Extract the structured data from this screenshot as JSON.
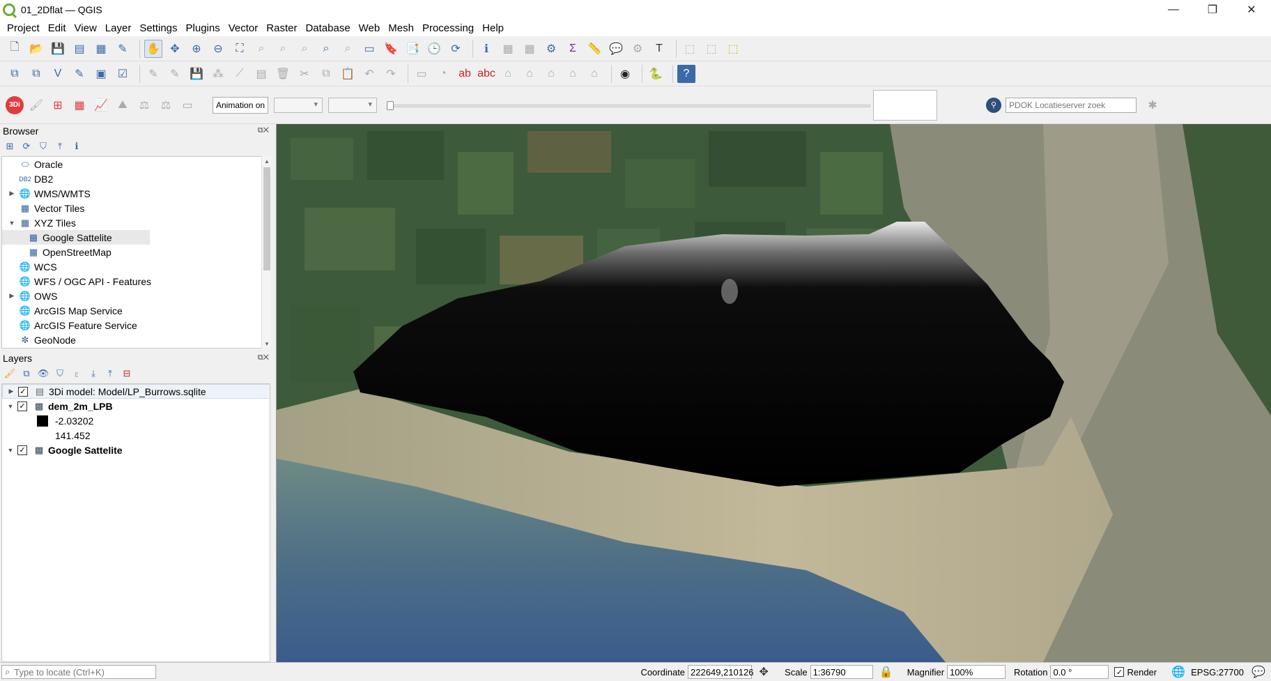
{
  "window": {
    "title": "01_2Dflat — QGIS",
    "controls": [
      "—",
      "❐",
      "✕"
    ]
  },
  "menu": [
    "Project",
    "Edit",
    "View",
    "Layer",
    "Settings",
    "Plugins",
    "Vector",
    "Raster",
    "Database",
    "Web",
    "Mesh",
    "Processing",
    "Help"
  ],
  "toolbar3": {
    "animation_label": "Animation on",
    "pdok_placeholder": "PDOK Locatieserver zoek",
    "threedi_icon": "3Di"
  },
  "browser": {
    "title": "Browser",
    "items": [
      {
        "label": "Oracle",
        "icon": "database-icon",
        "expand": ""
      },
      {
        "label": "DB2",
        "icon": "db2-icon",
        "expand": ""
      },
      {
        "label": "WMS/WMTS",
        "icon": "globe-icon",
        "expand": "▶"
      },
      {
        "label": "Vector Tiles",
        "icon": "grid-icon",
        "expand": ""
      },
      {
        "label": "XYZ Tiles",
        "icon": "grid-icon",
        "expand": "▼"
      },
      {
        "label": "Google Sattelite",
        "icon": "grid-icon",
        "expand": ""
      },
      {
        "label": "OpenStreetMap",
        "icon": "grid-icon",
        "expand": ""
      },
      {
        "label": "WCS",
        "icon": "globe-icon",
        "expand": ""
      },
      {
        "label": "WFS / OGC API - Features",
        "icon": "globe-icon",
        "expand": ""
      },
      {
        "label": "OWS",
        "icon": "globe-icon",
        "expand": "▶"
      },
      {
        "label": "ArcGIS Map Service",
        "icon": "globe-icon",
        "expand": ""
      },
      {
        "label": "ArcGIS Feature Service",
        "icon": "globe-icon",
        "expand": ""
      },
      {
        "label": "GeoNode",
        "icon": "geonode-icon",
        "expand": ""
      }
    ]
  },
  "layers": {
    "title": "Layers",
    "items": [
      {
        "label": "3Di model: Model/LP_Burrows.sqlite",
        "expand": "▶",
        "checked": true
      },
      {
        "label": "dem_2m_LPB",
        "expand": "▼",
        "checked": true
      },
      {
        "label": "-2.03202",
        "swatch": "#000000"
      },
      {
        "label": "141.452",
        "swatch": "#ffffff"
      },
      {
        "label": "Google Sattelite",
        "expand": "▼",
        "checked": true
      }
    ]
  },
  "status": {
    "locate_placeholder": "Type to locate (Ctrl+K)",
    "coordinate_label": "Coordinate",
    "coordinate_value": "222649,210126",
    "scale_label": "Scale",
    "scale_value": "1:36790",
    "magnifier_label": "Magnifier",
    "magnifier_value": "100%",
    "rotation_label": "Rotation",
    "rotation_value": "0.0 °",
    "render_label": "Render",
    "crs": "EPSG:27700"
  }
}
